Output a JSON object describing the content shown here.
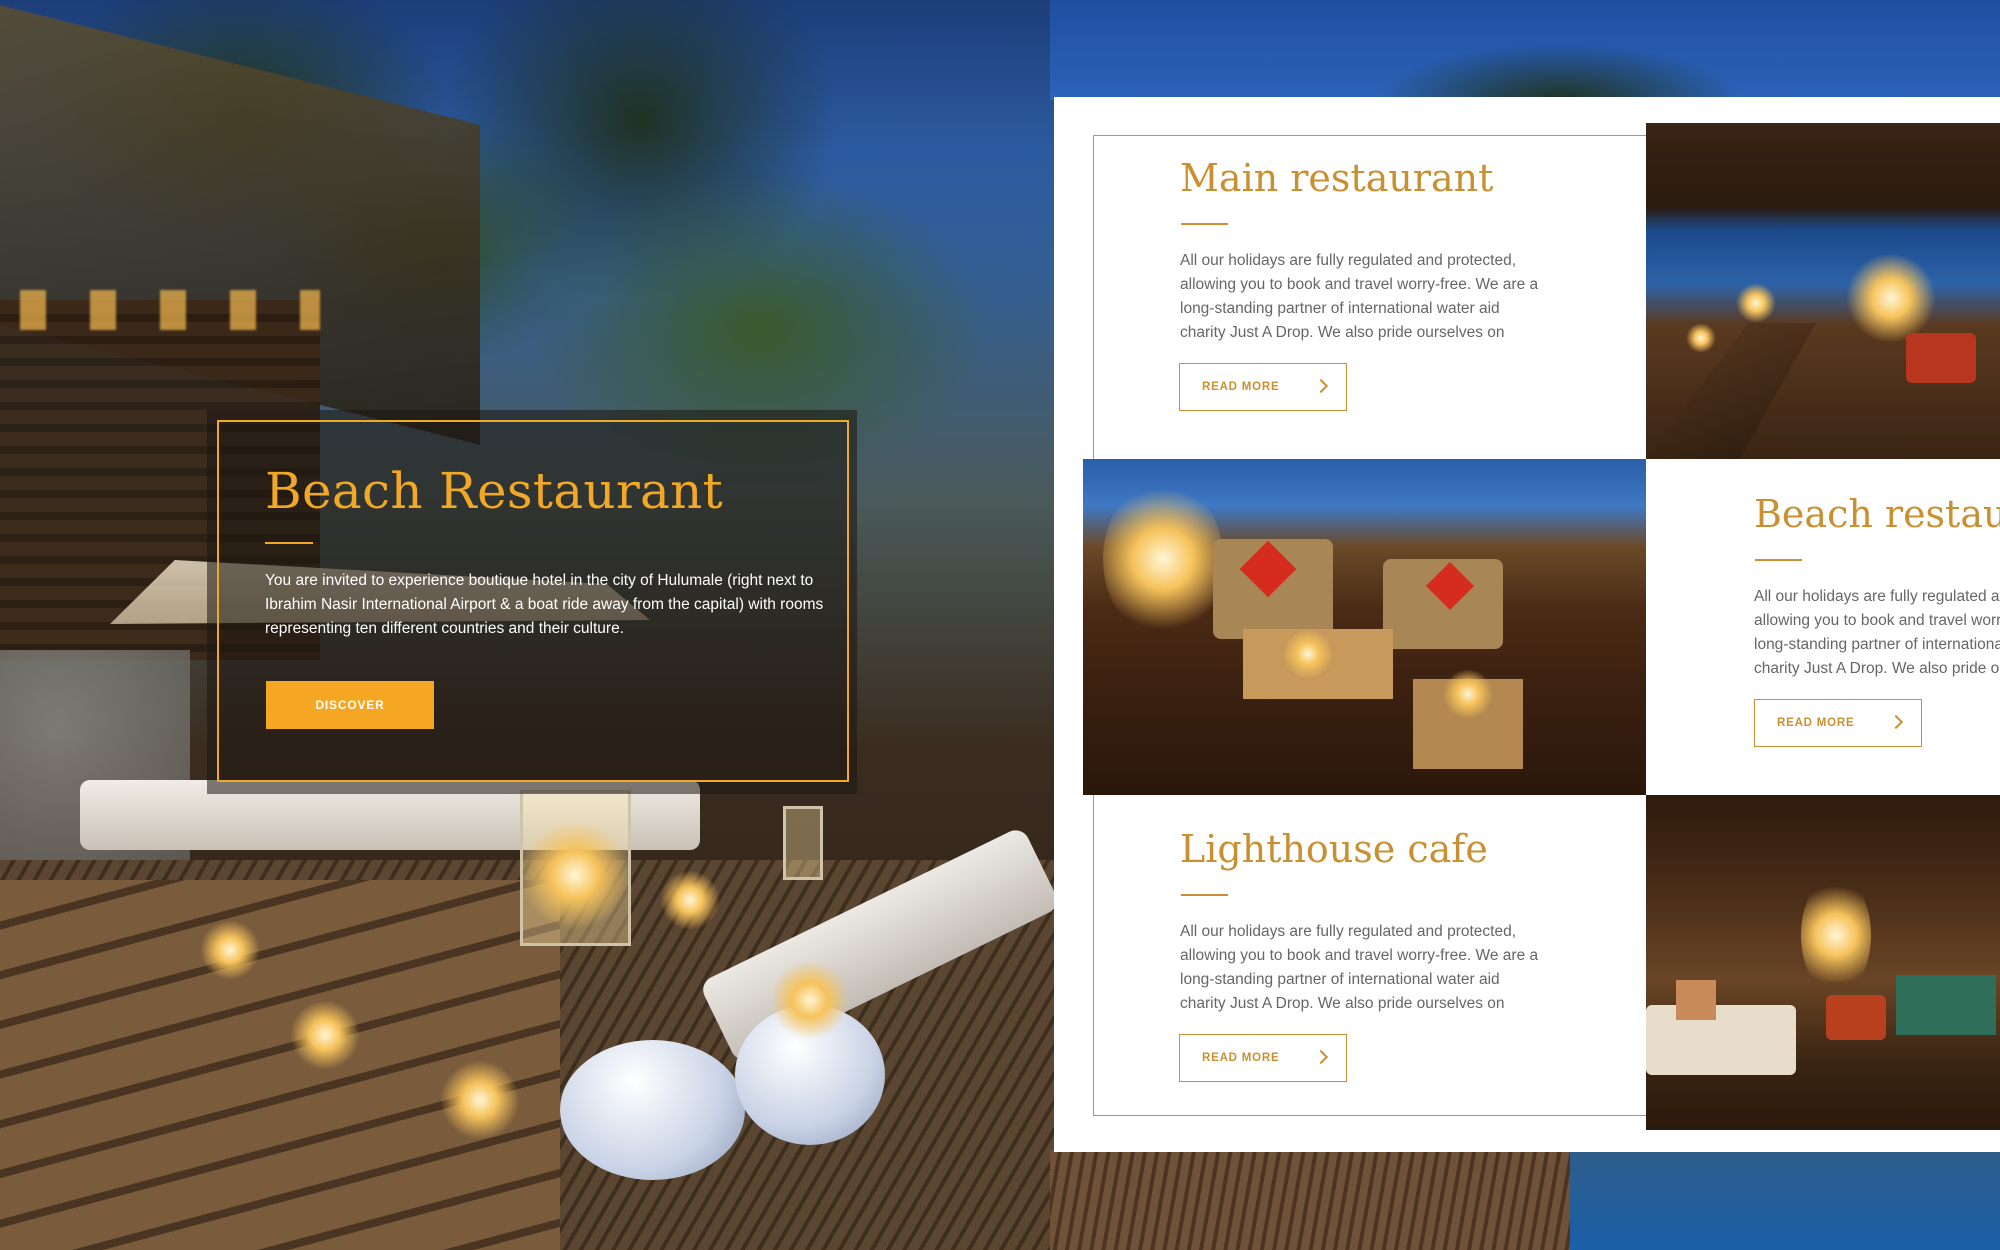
{
  "hero": {
    "title": "Beach Restaurant",
    "description": "You are invited to experience boutique hotel in the city of Hulumale (right next to Ibrahim Nasir International Airport & a boat ride away from the capital) with rooms representing ten different countries and their culture.",
    "button_label": "DISCOVER"
  },
  "restaurants": [
    {
      "title": "Main restaurant",
      "description": "All our holidays are fully regulated and protected, allowing you to book and travel worry-free. We are a long-standing partner of international water aid charity Just A Drop. We also pride ourselves on",
      "button_label": "READ MORE"
    },
    {
      "title": "Beach restaurant",
      "description": "All our holidays are fully regulated and protected, allowing you to book and travel worry-free. We are a long-standing partner of international water aid charity Just A Drop. We also pride ourselves on",
      "button_label": "READ MORE"
    },
    {
      "title": "Lighthouse cafe",
      "description": "All our holidays are fully regulated and protected, allowing you to book and travel worry-free. We are a long-standing partner of international water aid charity Just A Drop. We also pride ourselves on",
      "button_label": "READ MORE"
    }
  ],
  "colors": {
    "accent": "#f5a623",
    "card_accent": "#c99032",
    "body_text": "#666666"
  },
  "icons": {
    "read_more": "chevron-right-icon"
  }
}
